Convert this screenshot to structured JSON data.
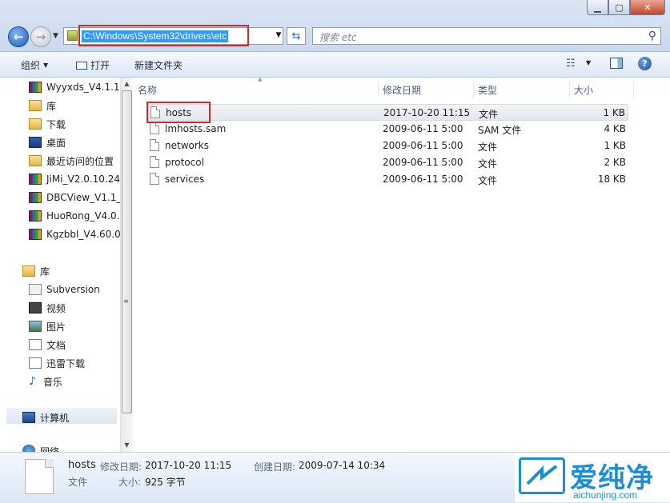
{
  "window": {
    "minimize_icon": "minimize-icon",
    "maximize_icon": "maximize-icon",
    "close_icon": "close-icon"
  },
  "address_bar": {
    "path": "C:\\Windows\\System32\\drivers\\etc",
    "search_placeholder": "搜索 etc"
  },
  "toolbar": {
    "organize": "组织",
    "open": "打开",
    "new_folder": "新建文件夹"
  },
  "nav": {
    "items": [
      {
        "label": "Wyyxds_V4.1.1.",
        "icon": "winrar-icon"
      },
      {
        "label": "库",
        "icon": "library-icon"
      },
      {
        "label": "下载",
        "icon": "downloads-icon"
      },
      {
        "label": "桌面",
        "icon": "desktop-icon"
      },
      {
        "label": "最近访问的位置",
        "icon": "recent-places-icon"
      },
      {
        "label": "JiMi_V2.0.10.24",
        "icon": "winrar-icon"
      },
      {
        "label": "DBCView_V1.1_",
        "icon": "winrar-icon"
      },
      {
        "label": "HuoRong_V4.0.",
        "icon": "winrar-icon"
      },
      {
        "label": "Kgzbbl_V4.60.0",
        "icon": "winrar-icon"
      }
    ],
    "library": {
      "title": "库",
      "items": [
        {
          "label": "Subversion",
          "icon": "subversion-icon"
        },
        {
          "label": "视频",
          "icon": "video-icon"
        },
        {
          "label": "图片",
          "icon": "pictures-icon"
        },
        {
          "label": "文档",
          "icon": "documents-icon"
        },
        {
          "label": "迅雷下载",
          "icon": "thunder-downloads-icon"
        },
        {
          "label": "音乐",
          "icon": "music-icon"
        }
      ]
    },
    "computer": "计算机",
    "network": "网络"
  },
  "columns": {
    "name": "名称",
    "modified": "修改日期",
    "type": "类型",
    "size": "大小"
  },
  "files": [
    {
      "name": "hosts",
      "modified": "2017-10-20 11:15",
      "type": "文件",
      "size": "1 KB",
      "selected": true
    },
    {
      "name": "lmhosts.sam",
      "modified": "2009-06-11 5:00",
      "type": "SAM 文件",
      "size": "4 KB",
      "selected": false
    },
    {
      "name": "networks",
      "modified": "2009-06-11 5:00",
      "type": "文件",
      "size": "1 KB",
      "selected": false
    },
    {
      "name": "protocol",
      "modified": "2009-06-11 5:00",
      "type": "文件",
      "size": "2 KB",
      "selected": false
    },
    {
      "name": "services",
      "modified": "2009-06-11 5:00",
      "type": "文件",
      "size": "18 KB",
      "selected": false
    }
  ],
  "details": {
    "name": "hosts",
    "modified_label": "修改日期:",
    "modified_value": "2017-10-20 11:15",
    "created_label": "创建日期:",
    "created_value": "2009-07-14 10:34",
    "type": "文件",
    "size_label": "大小:",
    "size_value": "925 字节"
  },
  "watermark": {
    "cn": "爱纯净",
    "en": "aichunjing.com"
  },
  "colors": {
    "highlight_red": "#d0282b",
    "selection_blue": "#3399ff",
    "watermark_blue": "#1a8fd8"
  }
}
